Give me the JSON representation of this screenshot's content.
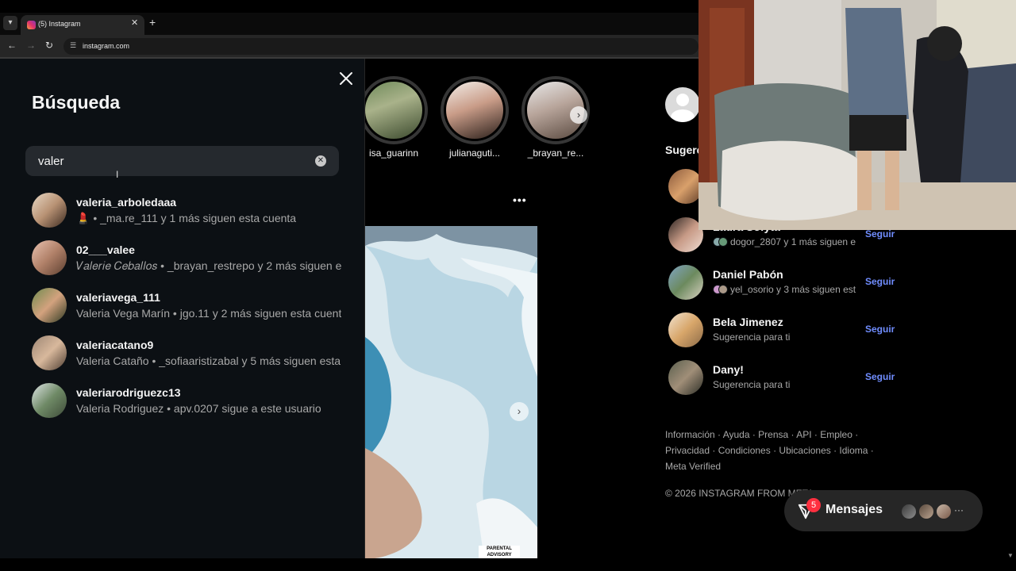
{
  "browser": {
    "tab_title": "(5) Instagram",
    "url": "instagram.com",
    "new_tab_symbol": "+",
    "tab_close_symbol": "✕",
    "back_symbol": "←",
    "forward_symbol": "→",
    "reload_symbol": "↻",
    "site_info_symbol": "☰"
  },
  "search": {
    "title": "Búsqueda",
    "query": "valer",
    "clear_symbol": "✕",
    "results": [
      {
        "username": "valeria_arboledaaa",
        "subtitle": "💄 • _ma.re_111 y 1 más siguen esta cuenta"
      },
      {
        "username": "02___valee",
        "subtitle": "𝑉𝑎𝑙𝑒𝑟𝑖𝑒 𝐶𝑒𝑏𝑎𝑙𝑙𝑜𝑠 • _brayan_restrepo y 2 más siguen es"
      },
      {
        "username": "valeriavega_111",
        "subtitle": "Valeria Vega Marín • jgo.11 y 2 más siguen esta cuenta"
      },
      {
        "username": "valeriacatano9",
        "subtitle": "Valeria Cataño • _sofiaaristizabal y 5 más siguen esta c"
      },
      {
        "username": "valeriarodriguezc13",
        "subtitle": "Valeria Rodriguez • apv.0207 sigue a este usuario"
      }
    ]
  },
  "stories": [
    {
      "name": "isa_guarinn"
    },
    {
      "name": "julianaguti..."
    },
    {
      "name": "_brayan_re..."
    }
  ],
  "story_next_symbol": "›",
  "post": {
    "more_symbol": "•••",
    "next_symbol": "›",
    "parental_label": "PARENTAL ADVISORY"
  },
  "sidebar": {
    "suggestions_title": "Sugere",
    "suggestions": [
      {
        "name": "Laura Sofyta",
        "subtitle": "dogor_2807 y 1 más siguen e",
        "action": "Seguir"
      },
      {
        "name": "Daniel Pabón",
        "subtitle": "yel_osorio y 3 más siguen est",
        "action": "Seguir"
      },
      {
        "name": "Bela Jimenez",
        "subtitle": "Sugerencia para ti",
        "action": "Seguir"
      },
      {
        "name": "Dany!",
        "subtitle": "Sugerencia para ti",
        "action": "Seguir"
      }
    ],
    "footer_links": "Información · Ayuda · Prensa · API · Empleo · Privacidad · Condiciones · Ubicaciones · Idioma · Meta Verified",
    "copyright": "© 2026 INSTAGRAM FROM META"
  },
  "messages": {
    "label": "Mensajes",
    "badge_count": "5",
    "more_symbol": "···"
  },
  "colors": {
    "background": "#000000",
    "panel": "#0c1014",
    "link": "#708dff",
    "badge": "#ff3040"
  }
}
